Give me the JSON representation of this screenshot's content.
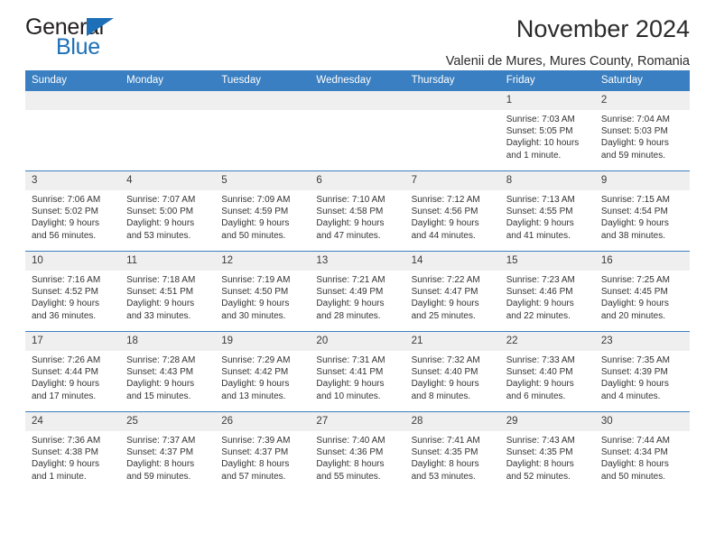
{
  "brand": {
    "name_part1": "General",
    "name_part2": "Blue",
    "triangle_icon": "brand-triangle-icon",
    "accent_color": "#1d70b7"
  },
  "header": {
    "title": "November 2024",
    "subtitle": "Valenii de Mures, Mures County, Romania"
  },
  "theme": {
    "header_row_bg": "#3a7fc1",
    "daynum_bg": "#efefef",
    "text_color": "#333333"
  },
  "calendar": {
    "weekday_headers": [
      "Sunday",
      "Monday",
      "Tuesday",
      "Wednesday",
      "Thursday",
      "Friday",
      "Saturday"
    ],
    "labels": {
      "sunrise": "Sunrise:",
      "sunset": "Sunset:",
      "daylight": "Daylight:"
    },
    "weeks": [
      [
        {
          "day": "",
          "empty": true
        },
        {
          "day": "",
          "empty": true
        },
        {
          "day": "",
          "empty": true
        },
        {
          "day": "",
          "empty": true
        },
        {
          "day": "",
          "empty": true
        },
        {
          "day": "1",
          "sunrise": "Sunrise: 7:03 AM",
          "sunset": "Sunset: 5:05 PM",
          "daylight": "Daylight: 10 hours and 1 minute."
        },
        {
          "day": "2",
          "sunrise": "Sunrise: 7:04 AM",
          "sunset": "Sunset: 5:03 PM",
          "daylight": "Daylight: 9 hours and 59 minutes."
        }
      ],
      [
        {
          "day": "3",
          "sunrise": "Sunrise: 7:06 AM",
          "sunset": "Sunset: 5:02 PM",
          "daylight": "Daylight: 9 hours and 56 minutes."
        },
        {
          "day": "4",
          "sunrise": "Sunrise: 7:07 AM",
          "sunset": "Sunset: 5:00 PM",
          "daylight": "Daylight: 9 hours and 53 minutes."
        },
        {
          "day": "5",
          "sunrise": "Sunrise: 7:09 AM",
          "sunset": "Sunset: 4:59 PM",
          "daylight": "Daylight: 9 hours and 50 minutes."
        },
        {
          "day": "6",
          "sunrise": "Sunrise: 7:10 AM",
          "sunset": "Sunset: 4:58 PM",
          "daylight": "Daylight: 9 hours and 47 minutes."
        },
        {
          "day": "7",
          "sunrise": "Sunrise: 7:12 AM",
          "sunset": "Sunset: 4:56 PM",
          "daylight": "Daylight: 9 hours and 44 minutes."
        },
        {
          "day": "8",
          "sunrise": "Sunrise: 7:13 AM",
          "sunset": "Sunset: 4:55 PM",
          "daylight": "Daylight: 9 hours and 41 minutes."
        },
        {
          "day": "9",
          "sunrise": "Sunrise: 7:15 AM",
          "sunset": "Sunset: 4:54 PM",
          "daylight": "Daylight: 9 hours and 38 minutes."
        }
      ],
      [
        {
          "day": "10",
          "sunrise": "Sunrise: 7:16 AM",
          "sunset": "Sunset: 4:52 PM",
          "daylight": "Daylight: 9 hours and 36 minutes."
        },
        {
          "day": "11",
          "sunrise": "Sunrise: 7:18 AM",
          "sunset": "Sunset: 4:51 PM",
          "daylight": "Daylight: 9 hours and 33 minutes."
        },
        {
          "day": "12",
          "sunrise": "Sunrise: 7:19 AM",
          "sunset": "Sunset: 4:50 PM",
          "daylight": "Daylight: 9 hours and 30 minutes."
        },
        {
          "day": "13",
          "sunrise": "Sunrise: 7:21 AM",
          "sunset": "Sunset: 4:49 PM",
          "daylight": "Daylight: 9 hours and 28 minutes."
        },
        {
          "day": "14",
          "sunrise": "Sunrise: 7:22 AM",
          "sunset": "Sunset: 4:47 PM",
          "daylight": "Daylight: 9 hours and 25 minutes."
        },
        {
          "day": "15",
          "sunrise": "Sunrise: 7:23 AM",
          "sunset": "Sunset: 4:46 PM",
          "daylight": "Daylight: 9 hours and 22 minutes."
        },
        {
          "day": "16",
          "sunrise": "Sunrise: 7:25 AM",
          "sunset": "Sunset: 4:45 PM",
          "daylight": "Daylight: 9 hours and 20 minutes."
        }
      ],
      [
        {
          "day": "17",
          "sunrise": "Sunrise: 7:26 AM",
          "sunset": "Sunset: 4:44 PM",
          "daylight": "Daylight: 9 hours and 17 minutes."
        },
        {
          "day": "18",
          "sunrise": "Sunrise: 7:28 AM",
          "sunset": "Sunset: 4:43 PM",
          "daylight": "Daylight: 9 hours and 15 minutes."
        },
        {
          "day": "19",
          "sunrise": "Sunrise: 7:29 AM",
          "sunset": "Sunset: 4:42 PM",
          "daylight": "Daylight: 9 hours and 13 minutes."
        },
        {
          "day": "20",
          "sunrise": "Sunrise: 7:31 AM",
          "sunset": "Sunset: 4:41 PM",
          "daylight": "Daylight: 9 hours and 10 minutes."
        },
        {
          "day": "21",
          "sunrise": "Sunrise: 7:32 AM",
          "sunset": "Sunset: 4:40 PM",
          "daylight": "Daylight: 9 hours and 8 minutes."
        },
        {
          "day": "22",
          "sunrise": "Sunrise: 7:33 AM",
          "sunset": "Sunset: 4:40 PM",
          "daylight": "Daylight: 9 hours and 6 minutes."
        },
        {
          "day": "23",
          "sunrise": "Sunrise: 7:35 AM",
          "sunset": "Sunset: 4:39 PM",
          "daylight": "Daylight: 9 hours and 4 minutes."
        }
      ],
      [
        {
          "day": "24",
          "sunrise": "Sunrise: 7:36 AM",
          "sunset": "Sunset: 4:38 PM",
          "daylight": "Daylight: 9 hours and 1 minute."
        },
        {
          "day": "25",
          "sunrise": "Sunrise: 7:37 AM",
          "sunset": "Sunset: 4:37 PM",
          "daylight": "Daylight: 8 hours and 59 minutes."
        },
        {
          "day": "26",
          "sunrise": "Sunrise: 7:39 AM",
          "sunset": "Sunset: 4:37 PM",
          "daylight": "Daylight: 8 hours and 57 minutes."
        },
        {
          "day": "27",
          "sunrise": "Sunrise: 7:40 AM",
          "sunset": "Sunset: 4:36 PM",
          "daylight": "Daylight: 8 hours and 55 minutes."
        },
        {
          "day": "28",
          "sunrise": "Sunrise: 7:41 AM",
          "sunset": "Sunset: 4:35 PM",
          "daylight": "Daylight: 8 hours and 53 minutes."
        },
        {
          "day": "29",
          "sunrise": "Sunrise: 7:43 AM",
          "sunset": "Sunset: 4:35 PM",
          "daylight": "Daylight: 8 hours and 52 minutes."
        },
        {
          "day": "30",
          "sunrise": "Sunrise: 7:44 AM",
          "sunset": "Sunset: 4:34 PM",
          "daylight": "Daylight: 8 hours and 50 minutes."
        }
      ]
    ]
  }
}
